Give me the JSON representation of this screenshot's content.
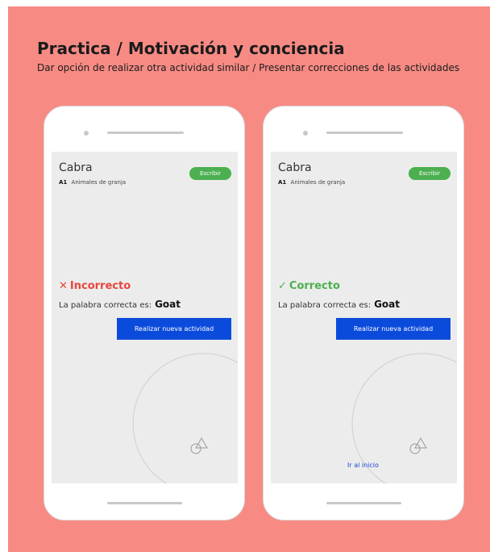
{
  "header": {
    "title": "Practica / Motivación y conciencia",
    "subtitle": "Dar opción de realizar otra actividad similar / Presentar correcciones de las actividades"
  },
  "screens": [
    {
      "word": "Cabra",
      "level": "A1",
      "category": "Animales de granja",
      "write_label": "Escribir",
      "result_mark": "✕",
      "result_label": "Incorrecto",
      "answer_prefix": "La palabra correcta es:",
      "answer_word": "Goat",
      "new_activity_label": "Realizar nueva actividad",
      "result_color": "#e8453c"
    },
    {
      "word": "Cabra",
      "level": "A1",
      "category": "Animales de granja",
      "write_label": "Escribir",
      "result_mark": "✓",
      "result_label": "Correcto",
      "answer_prefix": "La palabra correcta es:",
      "answer_word": "Goat",
      "new_activity_label": "Realizar nueva actividad",
      "home_link_label": "Ir al inicio",
      "result_color": "#4caf50"
    }
  ],
  "colors": {
    "background": "#f78b84",
    "accent_green": "#4caf50",
    "primary_blue": "#0b4bdc"
  },
  "icons": [
    "shapes-icon"
  ]
}
